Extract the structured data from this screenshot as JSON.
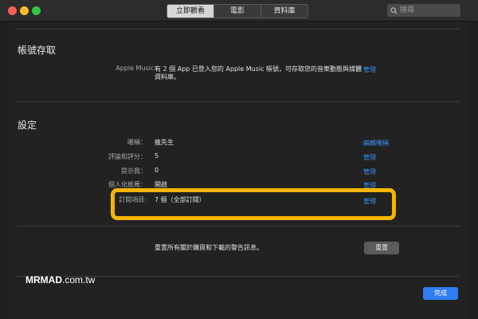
{
  "titlebar": {
    "tabs": [
      {
        "label": "立即觀看",
        "active": true
      },
      {
        "label": "電影",
        "active": false
      },
      {
        "label": "資料庫",
        "active": false
      }
    ],
    "search": {
      "placeholder": "搜尋",
      "icon": "search-icon"
    }
  },
  "account": {
    "title": "帳號存取",
    "apple_music_label": "Apple Music:",
    "apple_music_text_line1": "有 2 個 App 已登入您的 Apple Music 帳號，可存取您的音樂動態與媒體",
    "apple_music_text_line2": "資料庫。",
    "manage": "管理"
  },
  "settings": {
    "title": "設定",
    "rows": [
      {
        "label": "暱稱：",
        "value": "瘋先生",
        "action": "編輯暱稱"
      },
      {
        "label": "評論和評分：",
        "value": "5",
        "action": "管理"
      },
      {
        "label": "提示我：",
        "value": "0",
        "action": "管理"
      },
      {
        "label": "個人化推薦：",
        "value": "開啟",
        "action": "管理"
      },
      {
        "label": "訂閱項目:",
        "value": "7 個（全部訂閱）",
        "action": "管理"
      }
    ]
  },
  "reset": {
    "text": "重置所有關於購買和下載的警告訊息。",
    "button": "重置"
  },
  "done_button": "完成",
  "watermark": {
    "brand": "MRMAD",
    "suffix": ".com.tw"
  },
  "colors": {
    "accent": "#2f7ef5",
    "link": "#3b8ef0",
    "highlight": "#f7b500"
  }
}
